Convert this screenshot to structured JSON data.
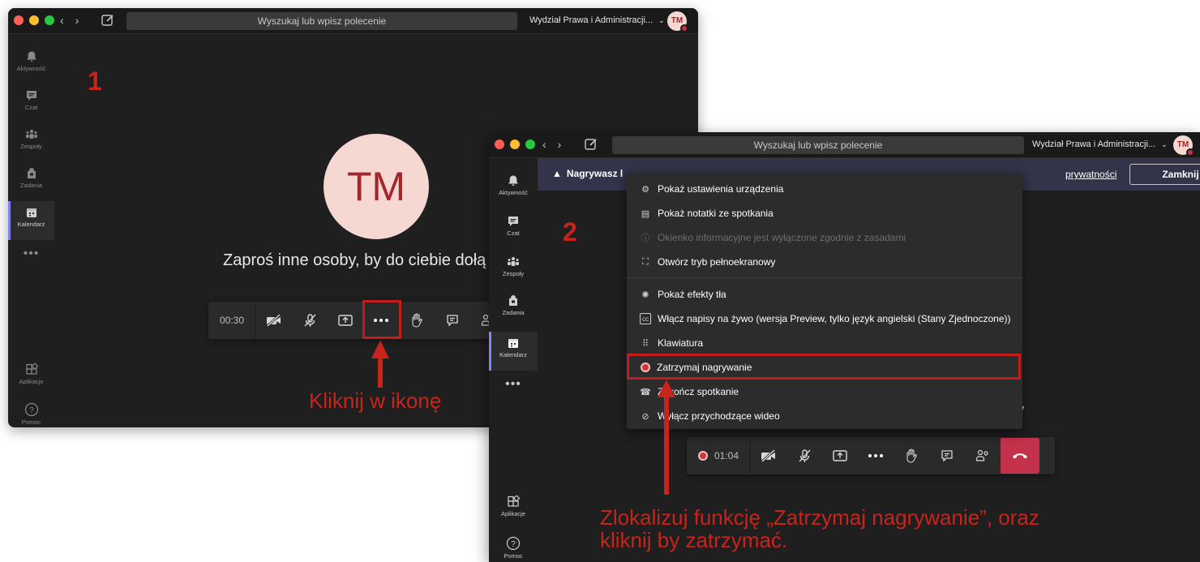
{
  "window1": {
    "search_placeholder": "Wyszukaj lub wpisz polecenie",
    "org_name": "Wydział Prawa i Administracji...",
    "avatar_initials": "TM",
    "rail": [
      {
        "label": "Aktywność",
        "icon": "bell-icon"
      },
      {
        "label": "Czat",
        "icon": "chat-icon"
      },
      {
        "label": "Zespoły",
        "icon": "teams-icon"
      },
      {
        "label": "Zadania",
        "icon": "tasks-icon"
      },
      {
        "label": "Kalendarz",
        "icon": "calendar-icon"
      }
    ],
    "rail_more": "•••",
    "rail_bottom": [
      {
        "label": "Aplikacje",
        "icon": "apps-icon"
      },
      {
        "label": "Pomoc",
        "icon": "help-icon"
      }
    ],
    "big_initials": "TM",
    "invite_text": "Zaproś inne osoby, by do ciebie dołą",
    "timer": "00:30"
  },
  "window2": {
    "search_placeholder": "Wyszukaj lub wpisz polecenie",
    "org_name": "Wydział Prawa i Administracji...",
    "avatar_initials": "TM",
    "rail": [
      {
        "label": "Aktywność",
        "icon": "bell-icon"
      },
      {
        "label": "Czat",
        "icon": "chat-icon"
      },
      {
        "label": "Zespoły",
        "icon": "teams-icon"
      },
      {
        "label": "Zadania",
        "icon": "tasks-icon"
      },
      {
        "label": "Kalendarz",
        "icon": "calendar-icon"
      }
    ],
    "rail_more": "•••",
    "rail_bottom": [
      {
        "label": "Aplikacje",
        "icon": "apps-icon"
      },
      {
        "label": "Pomoc",
        "icon": "help-icon"
      }
    ],
    "banner": {
      "warning_text": "Nagrywasz l",
      "privacy_link": "prywatności",
      "close_label": "Zamknij"
    },
    "behind_text": "y",
    "timer": "01:04",
    "menu": [
      {
        "label": "Pokaż ustawienia urządzenia",
        "icon": "gear-icon",
        "disabled": false
      },
      {
        "label": "Pokaż notatki ze spotkania",
        "icon": "notes-icon",
        "disabled": false
      },
      {
        "label": "Okienko informacyjne jest wyłączone zgodnie z zasadami",
        "icon": "info-icon",
        "disabled": true
      },
      {
        "label": "Otwórz tryb pełnoekranowy",
        "icon": "fullscreen-icon",
        "disabled": false
      },
      {
        "label": "Pokaż efekty tła",
        "icon": "background-effects-icon",
        "disabled": false
      },
      {
        "label": "Włącz napisy na żywo (wersja Preview, tylko język angielski (Stany Zjednoczone))",
        "icon": "captions-icon",
        "disabled": false
      },
      {
        "label": "Klawiatura",
        "icon": "keypad-icon",
        "disabled": false
      },
      {
        "label": "Zatrzymaj nagrywanie",
        "icon": "record-icon",
        "disabled": false
      },
      {
        "label": "Zakończ spotkanie",
        "icon": "end-meeting-icon",
        "disabled": false
      },
      {
        "label": "Wyłącz przychodzące wideo",
        "icon": "video-off-icon",
        "disabled": false
      }
    ]
  },
  "annotations": {
    "step1": "1",
    "step2": "2",
    "text1": "Kliknij w ikonę",
    "text2_line1": "Zlokalizuj funkcję „Zatrzymaj nagrywanie”, oraz",
    "text2_line2": "kliknij by zatrzymać."
  },
  "colors": {
    "annotation_red": "#c7241b",
    "hangup_red": "#c4314b",
    "accent_purple": "#7f85f5",
    "avatar_bg": "#f4d8d1"
  }
}
